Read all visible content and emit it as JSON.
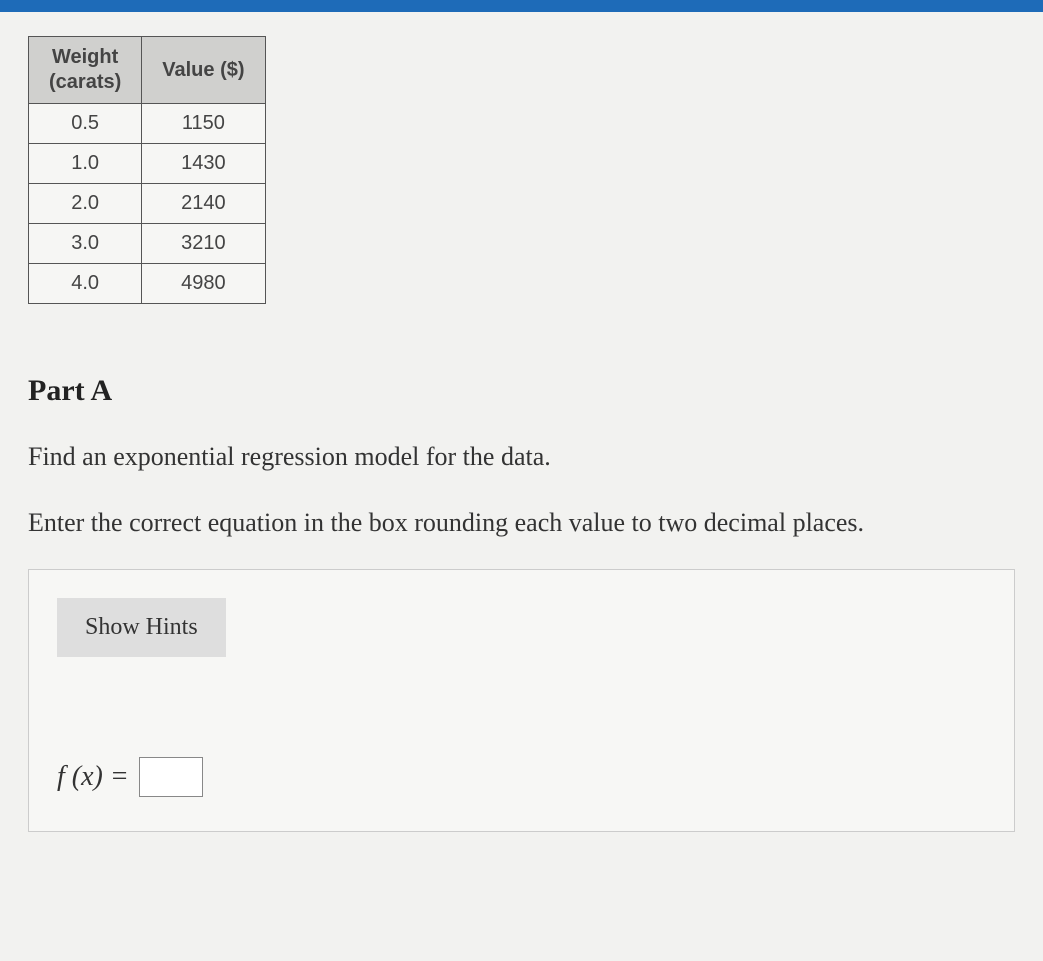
{
  "table": {
    "headers": [
      "Weight\n(carats)",
      "Value ($)"
    ],
    "rows": [
      [
        "0.5",
        "1150"
      ],
      [
        "1.0",
        "1430"
      ],
      [
        "2.0",
        "2140"
      ],
      [
        "3.0",
        "3210"
      ],
      [
        "4.0",
        "4980"
      ]
    ]
  },
  "part": {
    "label": "Part A"
  },
  "instructions": {
    "line1": "Find an exponential regression model for the data.",
    "line2": "Enter the correct equation in the box rounding each value to two decimal places."
  },
  "panel": {
    "hints_label": "Show Hints",
    "equation_label": "f (x) =",
    "equation_value": ""
  },
  "chart_data": {
    "type": "table",
    "columns": [
      "Weight (carats)",
      "Value ($)"
    ],
    "rows": [
      [
        0.5,
        1150
      ],
      [
        1.0,
        1430
      ],
      [
        2.0,
        2140
      ],
      [
        3.0,
        3210
      ],
      [
        4.0,
        4980
      ]
    ]
  }
}
